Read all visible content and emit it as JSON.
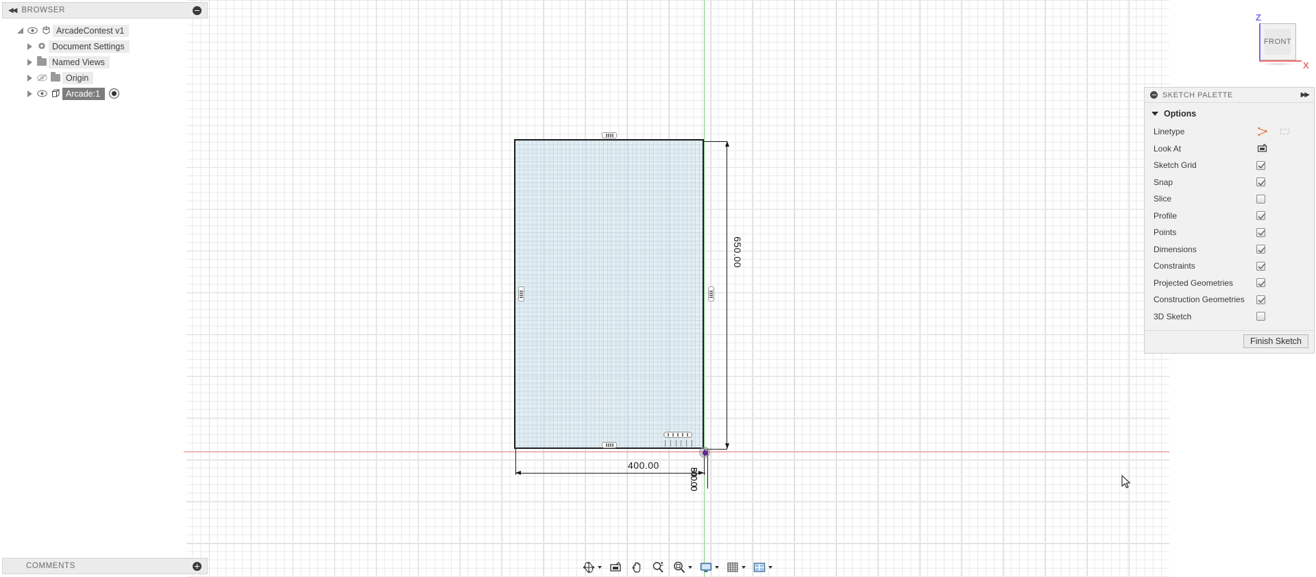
{
  "app": {
    "view_label": "FRONT",
    "axis_z_label": "Z",
    "axis_x_label": "X"
  },
  "browser": {
    "header_title": "BROWSER",
    "collapse_icon": "double-left-arrow-icon",
    "minimize_icon": "minus-circle-icon",
    "items": [
      {
        "label": "ArcadeContest v1",
        "icon": "component-icon",
        "expander": "triangle-down-filled",
        "visibility": "eye-visible-icon",
        "selected": false,
        "indent": 0
      },
      {
        "label": "Document Settings",
        "icon": "gear-icon",
        "expander": "triangle-right",
        "visibility": "none",
        "selected": false,
        "indent": 1
      },
      {
        "label": "Named Views",
        "icon": "folder-icon",
        "expander": "triangle-right",
        "visibility": "none",
        "selected": false,
        "indent": 1
      },
      {
        "label": "Origin",
        "icon": "folder-icon",
        "expander": "triangle-right",
        "visibility": "eye-hidden-icon",
        "selected": false,
        "indent": 1
      },
      {
        "label": "Arcade:1",
        "icon": "body-cube-icon",
        "expander": "triangle-right",
        "visibility": "eye-visible-icon",
        "selected": true,
        "indent": 1,
        "radio": true
      }
    ]
  },
  "sketch_palette": {
    "header_title": "SKETCH PALETTE",
    "collapse_icon": "minus-circle-icon",
    "expand_icon": "double-right-arrow-icon",
    "section_title": "Options",
    "options": [
      {
        "label": "Linetype",
        "control": "icons",
        "icons": [
          "construction-line-icon",
          "centerline-icon"
        ]
      },
      {
        "label": "Look At",
        "control": "icon",
        "icons": [
          "look-at-icon"
        ]
      },
      {
        "label": "Sketch Grid",
        "control": "checkbox",
        "checked": true
      },
      {
        "label": "Snap",
        "control": "checkbox",
        "checked": true
      },
      {
        "label": "Slice",
        "control": "checkbox",
        "checked": false
      },
      {
        "label": "Profile",
        "control": "checkbox",
        "checked": true
      },
      {
        "label": "Points",
        "control": "checkbox",
        "checked": true
      },
      {
        "label": "Dimensions",
        "control": "checkbox",
        "checked": true
      },
      {
        "label": "Constraints",
        "control": "checkbox",
        "checked": true
      },
      {
        "label": "Projected Geometries",
        "control": "checkbox",
        "checked": true
      },
      {
        "label": "Construction Geometries",
        "control": "checkbox",
        "checked": true
      },
      {
        "label": "3D Sketch",
        "control": "checkbox",
        "checked": false
      }
    ],
    "finish_button": "Finish Sketch"
  },
  "sketch": {
    "dimension_vertical": "650.00",
    "dimension_horizontal": "400.00",
    "dimension_overlap_a": "540.00",
    "dimension_overlap_b": "800.00",
    "constraint_cluster_label": ""
  },
  "comments": {
    "title": "COMMENTS",
    "add_icon": "plus-circle-icon"
  },
  "navbar": {
    "items": [
      {
        "name": "orbit",
        "icon": "orbit-icon",
        "has_caret": true
      },
      {
        "name": "look-at",
        "icon": "look-at-icon",
        "has_caret": false
      },
      {
        "name": "pan",
        "icon": "pan-hand-icon",
        "has_caret": false
      },
      {
        "name": "zoom",
        "icon": "zoom-magnifier-icon",
        "has_caret": false
      },
      {
        "name": "fit",
        "icon": "fit-magnifier-icon",
        "has_caret": true
      },
      {
        "name": "display-settings",
        "icon": "monitor-icon",
        "has_caret": true
      },
      {
        "name": "grid-snaps",
        "icon": "grid-icon",
        "has_caret": true
      },
      {
        "name": "viewports",
        "icon": "viewports-icon",
        "has_caret": true
      }
    ]
  },
  "colors": {
    "axis_x": "#f08080",
    "axis_z": "#7fd17f",
    "origin_point": "#5b2d8e",
    "profile_fill": "#cee4ec",
    "selection": "#7d7d7d"
  }
}
